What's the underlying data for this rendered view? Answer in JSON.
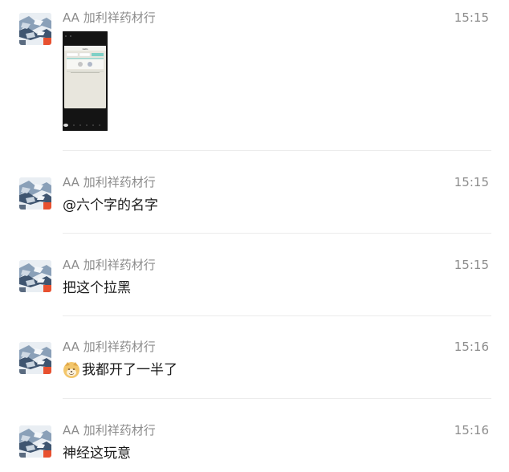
{
  "messages": [
    {
      "sender": "AA  加利祥药材行",
      "time": "15:15",
      "type": "image",
      "image_thumbnail": {
        "title": "Hello",
        "rows": [
          "",
          "",
          ""
        ]
      }
    },
    {
      "sender": "AA  加利祥药材行",
      "time": "15:15",
      "type": "text",
      "text": "@六个字的名字"
    },
    {
      "sender": "AA  加利祥药材行",
      "time": "15:15",
      "type": "text",
      "text": "把这个拉黑"
    },
    {
      "sender": "AA  加利祥药材行",
      "time": "15:16",
      "type": "text",
      "emoji": "doge-emoji",
      "text": "我都开了一半了"
    },
    {
      "sender": "AA  加利祥药材行",
      "time": "15:16",
      "type": "text",
      "text": "神经这玩意"
    }
  ],
  "colors": {
    "sender": "#8c8c8c",
    "time": "#8c8c8c",
    "text": "#1a1a1a",
    "divider": "#ececec",
    "avatar_badge": "#e8502f"
  }
}
